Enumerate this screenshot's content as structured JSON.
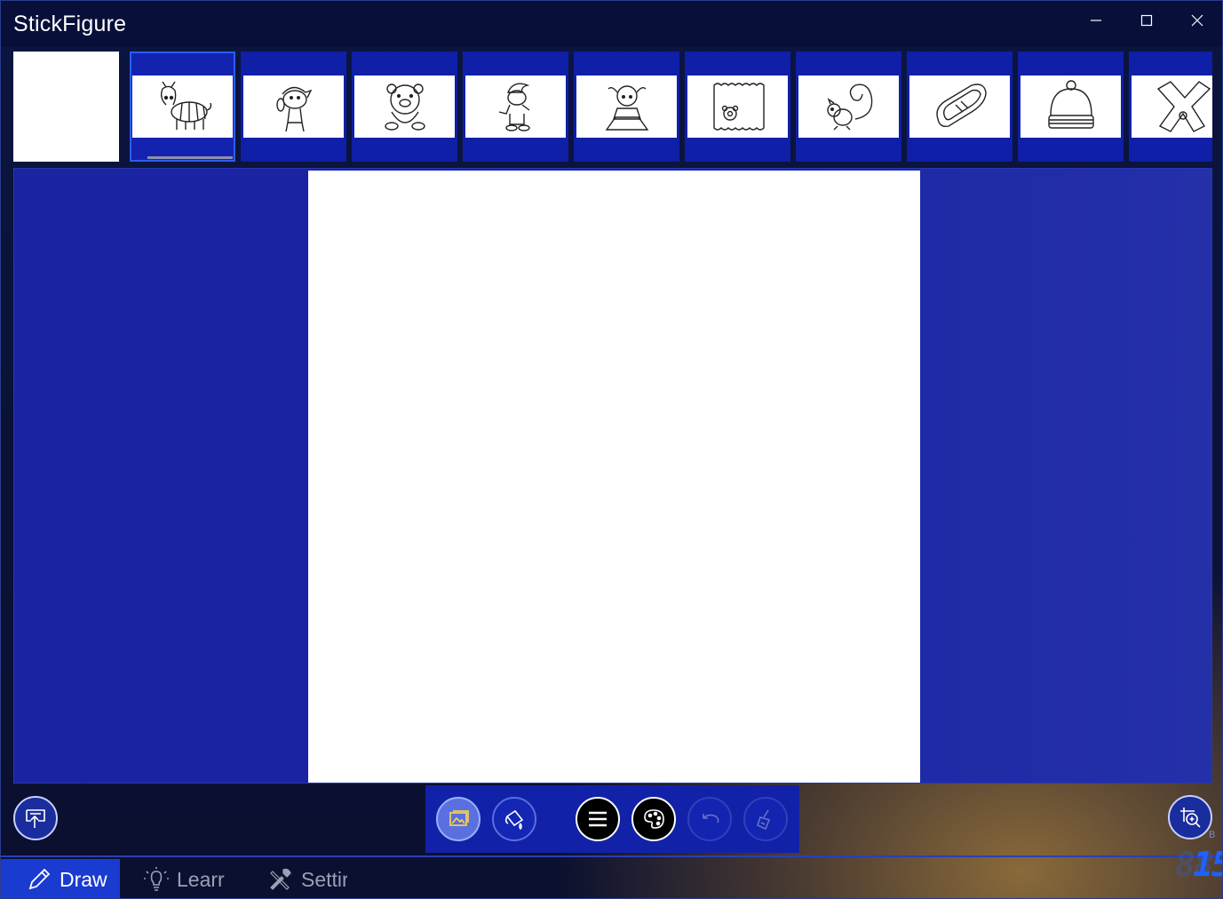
{
  "window": {
    "title": "StickFigure",
    "controls": {
      "minimize": "minimize-icon",
      "maximize": "maximize-icon",
      "close": "close-icon"
    }
  },
  "templates": [
    {
      "name": "blank",
      "icon": "blank-page"
    },
    {
      "name": "zebra",
      "icon": "zebra-outline",
      "selected": true
    },
    {
      "name": "boy-with-cap",
      "icon": "boy-cap-outline"
    },
    {
      "name": "pig",
      "icon": "pig-outline"
    },
    {
      "name": "smurf",
      "icon": "smurf-outline"
    },
    {
      "name": "girl-reading",
      "icon": "girl-reading-outline"
    },
    {
      "name": "bear-frame",
      "icon": "bear-frame-outline"
    },
    {
      "name": "squirrel",
      "icon": "squirrel-outline"
    },
    {
      "name": "shoe",
      "icon": "shoe-outline"
    },
    {
      "name": "winter-hat",
      "icon": "hat-outline"
    },
    {
      "name": "scarf",
      "icon": "scarf-outline"
    }
  ],
  "toolbar": {
    "share": "share-icon",
    "zoom": "zoom-icon",
    "tools": [
      "image-icon",
      "paint-bucket-icon",
      "menu-icon",
      "palette-icon",
      "undo-icon",
      "clear-brush-icon"
    ]
  },
  "nav": {
    "draw": "Draw",
    "learn": "Learr",
    "settings": "Settir"
  },
  "clock": {
    "ghost": "88",
    "value": "15",
    "label": "B"
  },
  "colors": {
    "accent": "#1a3bd0",
    "stage": "#1a23a0",
    "canvas": "#ffffff"
  }
}
